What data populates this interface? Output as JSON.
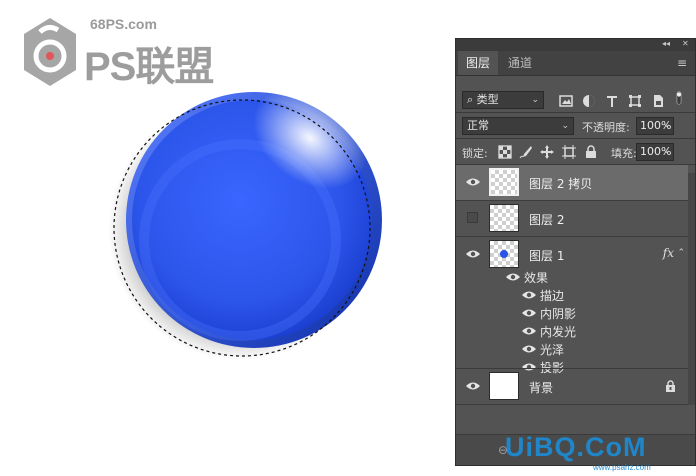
{
  "watermark_top": {
    "site": "68PS.com",
    "brand": "PS联盟"
  },
  "watermark_bottom": {
    "brand": "UiBQ.CoM",
    "url": "www.psahz.com"
  },
  "panel": {
    "collapse_glyph": "◂◂",
    "close_glyph": "✕",
    "tabs": [
      {
        "label": "图层",
        "active": true
      },
      {
        "label": "通道",
        "active": false
      }
    ],
    "menu_glyph": "≡",
    "filter": {
      "search_glyph": "⌕",
      "kind_label": "类型",
      "icons": [
        "image-filter-icon",
        "adjustment-filter-icon",
        "type-filter-icon",
        "shape-filter-icon",
        "smart-object-filter-icon",
        "filter-toggle-icon"
      ]
    },
    "blend": {
      "mode": "正常",
      "opacity_label": "不透明度:",
      "opacity_value": "100%"
    },
    "lock": {
      "label": "锁定:",
      "icons": [
        "lock-transparent-icon",
        "lock-image-icon",
        "lock-position-icon",
        "lock-artboard-icon",
        "lock-all-icon"
      ],
      "fill_label": "填充:",
      "fill_value": "100%"
    },
    "layers": [
      {
        "name": "图层 2 拷贝",
        "visible": true,
        "selected": true,
        "thumb": "checker"
      },
      {
        "name": "图层 2",
        "visible": false,
        "selected": false,
        "thumb": "checker"
      },
      {
        "name": "图层 1",
        "visible": true,
        "selected": false,
        "thumb": "dot",
        "fx": "fx"
      },
      {
        "name": "背景",
        "visible": true,
        "selected": false,
        "thumb": "white",
        "locked": true
      }
    ],
    "effects_header": "效果",
    "effects": [
      "描边",
      "内阴影",
      "内发光",
      "光泽",
      "投影"
    ],
    "bottom_link_glyph": "⊖"
  },
  "colors": {
    "orb_blue": "#2b53e8",
    "panel_bg": "#535353"
  }
}
